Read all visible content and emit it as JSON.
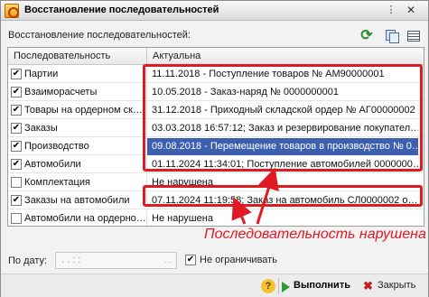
{
  "window": {
    "title": "Восстановление последовательностей",
    "more_glyph": "⋮",
    "close_glyph": "✕"
  },
  "section": {
    "label": "Восстановление последовательностей:"
  },
  "toolbar": {
    "refresh_icon": "refresh-icon",
    "copy_icon": "copy-icon",
    "grid_icon": "list-settings-icon"
  },
  "table": {
    "headers": [
      "Последовательность",
      "Актуальна"
    ],
    "rows": [
      {
        "checked": "✔",
        "name": "Партии",
        "status": "11.11.2018 - Поступление товаров № АМ90000001"
      },
      {
        "checked": "✔",
        "name": "Взаиморасчеты",
        "status": "10.05.2018 - Заказ-наряд № 0000000001"
      },
      {
        "checked": "✔",
        "name": "Товары на ордерном ск…",
        "status": "31.12.2018 - Приходный складской ордер № АГ00000002"
      },
      {
        "checked": "✔",
        "name": "Заказы",
        "status": "03.03.2018 16:57:12; Заказ и резервирование покупател…"
      },
      {
        "checked": "✔",
        "name": "Производство",
        "status": "09.08.2018 - Перемещение товаров в производство № 0…"
      },
      {
        "checked": "✔",
        "name": "Автомобили",
        "status": "01.11.2024 11:34:01; Поступление автомобилей 0000000…"
      },
      {
        "checked": "",
        "name": "Комплектация",
        "status": "Не нарушена"
      },
      {
        "checked": "✔",
        "name": "Заказы на автомобили",
        "status": "07.11.2024 11:19:58; Заказ на автомобиль СЛ0000002 о…"
      },
      {
        "checked": "",
        "name": "Автомобили на ордерно…",
        "status": "Не нарушена"
      }
    ]
  },
  "annotation": {
    "text": "Последовательность нарушена",
    "color": "#e01a22"
  },
  "date_filter": {
    "label": "По дату:",
    "value": " .  .    :  :  ",
    "picker_glyph": "…",
    "no_limit_checked": "✔",
    "no_limit_label": "Не ограничивать"
  },
  "footer": {
    "help_glyph": "?",
    "run_label": "Выполнить",
    "close_glyph": "✖",
    "close_label": "Закрыть"
  },
  "colors": {
    "selection": "#3c5fb0",
    "accent_red": "#e01a22",
    "run_green": "#2e9a33"
  }
}
